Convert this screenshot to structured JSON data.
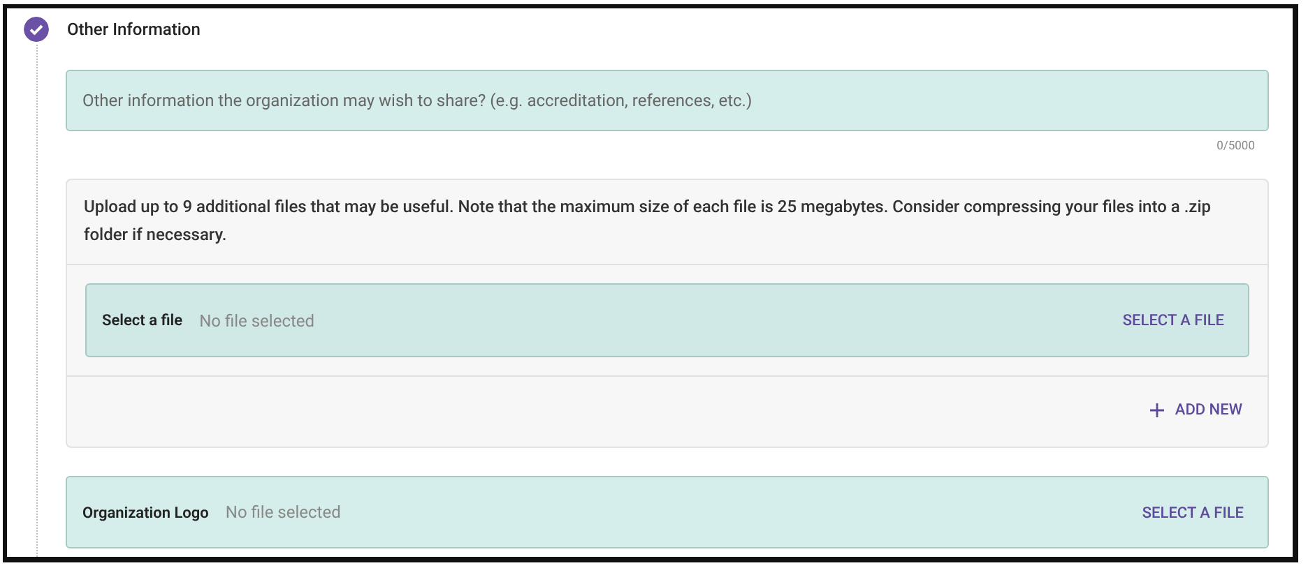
{
  "step": {
    "title": "Other Information",
    "completed": true
  },
  "textarea": {
    "placeholder": "Other information the organization may wish to share? (e.g. accreditation, references, etc.)",
    "counter": "0/5000"
  },
  "uploads": {
    "note": "Upload up to 9 additional files that may be useful. Note that the maximum size of each file is 25 megabytes. Consider compressing your files into a .zip folder if necessary.",
    "files": [
      {
        "label": "Select a file",
        "value": "No file selected",
        "action": "SELECT A FILE"
      }
    ],
    "add_button": "ADD NEW"
  },
  "logo": {
    "label": "Organization Logo",
    "value": "No file selected",
    "action": "SELECT A FILE"
  }
}
